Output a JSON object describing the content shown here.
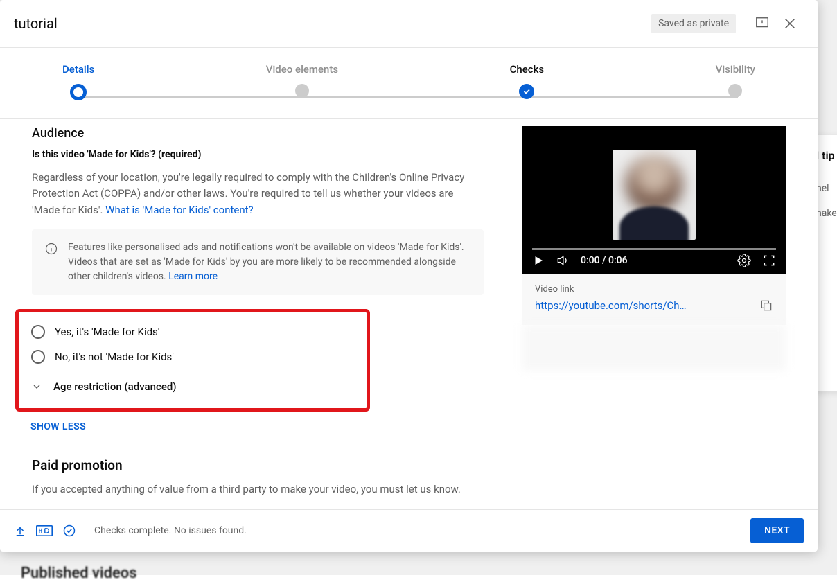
{
  "header": {
    "title": "tutorial",
    "saved_badge": "Saved as private"
  },
  "stepper": {
    "details": "Details",
    "video_elements": "Video elements",
    "checks": "Checks",
    "visibility": "Visibility"
  },
  "audience": {
    "section_title": "Audience",
    "question": "Is this video 'Made for Kids'? (required)",
    "para_text": "Regardless of your location, you're legally required to comply with the Children's Online Privacy Protection Act (COPPA) and/or other laws. You're required to tell us whether your videos are 'Made for Kids'. ",
    "para_link": "What is 'Made for Kids' content?",
    "info_text": "Features like personalised ads and notifications won't be available on videos 'Made for Kids'. Videos that are set as 'Made for Kids' by you are more likely to be recommended alongside other children's videos. ",
    "info_link": "Learn more",
    "radio_yes": "Yes, it's 'Made for Kids'",
    "radio_no": "No, it's not 'Made for Kids'",
    "age_restriction": "Age restriction (advanced)",
    "show_less": "SHOW LESS"
  },
  "paid": {
    "section_title": "Paid promotion",
    "para": "If you accepted anything of value from a third party to make your video, you must let us know."
  },
  "player": {
    "time": "0:00 / 0:06"
  },
  "link_card": {
    "label": "Video link",
    "url": "https://youtube.com/shorts/Ch…"
  },
  "footer": {
    "status": "Checks complete. No issues found.",
    "next": "NEXT"
  },
  "backdrop": {
    "tips_title": "l tip",
    "tips_body_1": " hel",
    "tips_body_2": "nake",
    "published": "Published videos"
  }
}
